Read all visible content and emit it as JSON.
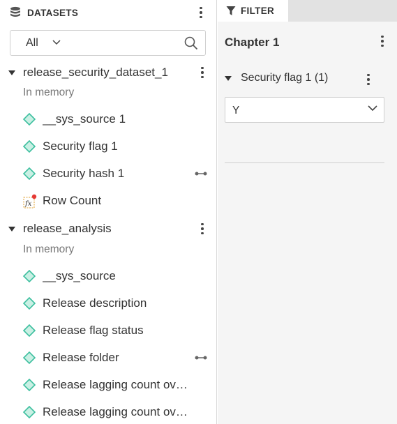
{
  "datasets": {
    "title": "DATASETS",
    "search": {
      "selected": "All"
    },
    "groups": [
      {
        "name": "release_security_dataset_1",
        "location": "In memory",
        "fields": [
          {
            "name": "__sys_source 1",
            "icon": "diamond-field-icon",
            "linked": false
          },
          {
            "name": "Security flag 1",
            "icon": "diamond-field-icon",
            "linked": false
          },
          {
            "name": "Security hash 1",
            "icon": "diamond-field-icon",
            "linked": true
          },
          {
            "name": "Row Count",
            "icon": "fx-formula-icon",
            "linked": false
          }
        ]
      },
      {
        "name": "release_analysis",
        "location": "In memory",
        "fields": [
          {
            "name": "__sys_source",
            "icon": "diamond-field-icon",
            "linked": false
          },
          {
            "name": "Release description",
            "icon": "diamond-field-icon",
            "linked": false
          },
          {
            "name": "Release flag status",
            "icon": "diamond-field-icon",
            "linked": false
          },
          {
            "name": "Release folder",
            "icon": "diamond-field-icon",
            "linked": true
          },
          {
            "name": "Release lagging count over time",
            "icon": "diamond-field-icon",
            "linked": false
          },
          {
            "name": "Release lagging count over period",
            "icon": "diamond-field-icon",
            "linked": false
          }
        ]
      }
    ]
  },
  "filter": {
    "tab_label": "FILTER",
    "chapter": "Chapter 1",
    "section": {
      "name": "Security flag 1 (1)",
      "value": "Y"
    }
  },
  "colors": {
    "field_icon": "#3dbf9f",
    "field_icon_fill": "#c9f0e4",
    "badge": "#e53935",
    "fx_border": "#e0a030"
  }
}
